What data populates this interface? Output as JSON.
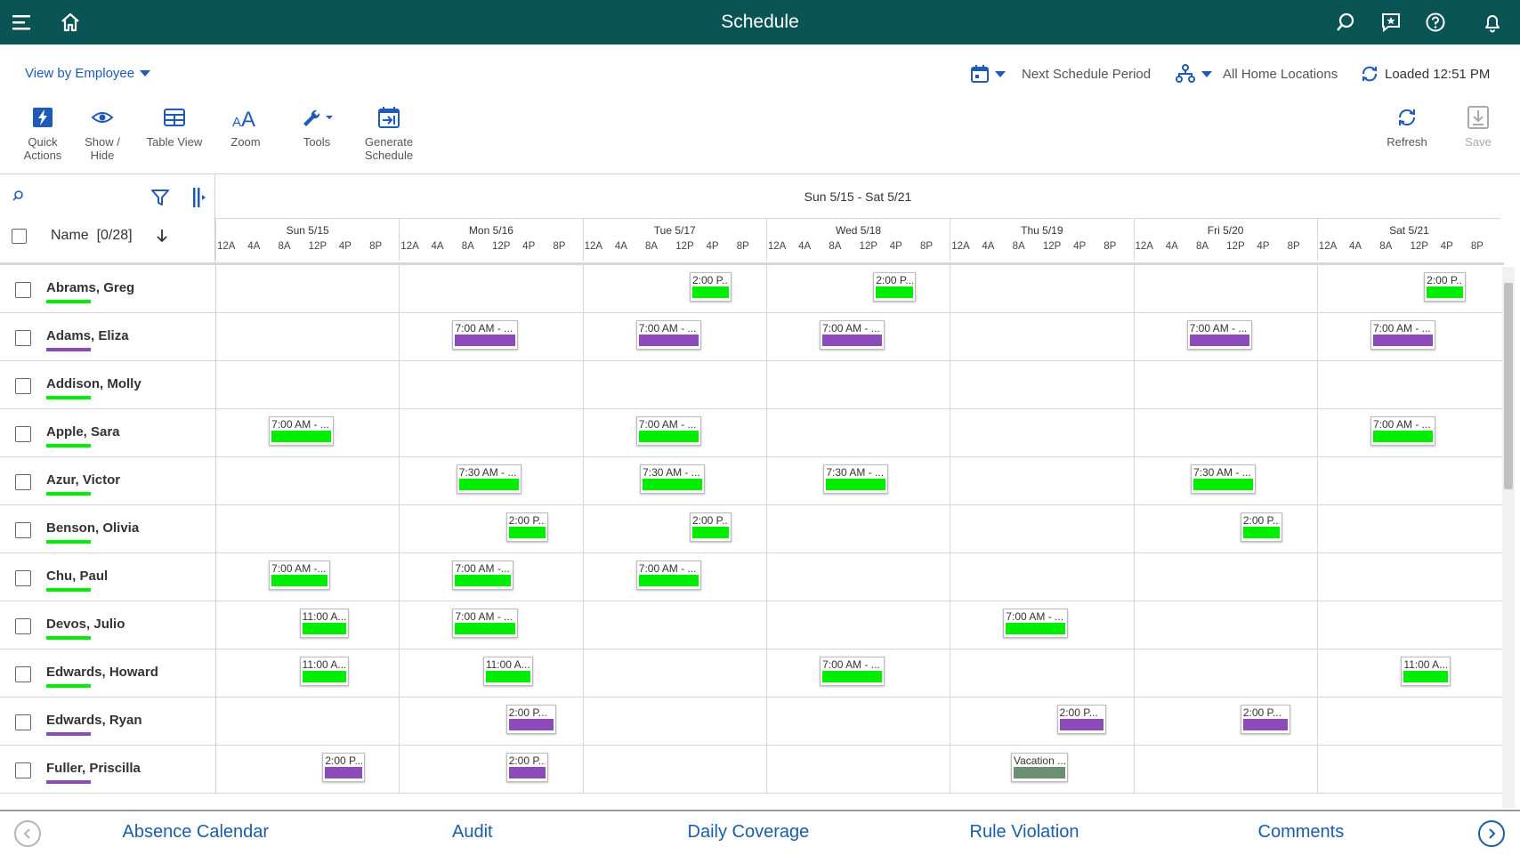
{
  "header": {
    "title": "Schedule"
  },
  "subheader": {
    "view_by": "View by Employee",
    "schedule_period": "Next Schedule Period",
    "locations": "All Home Locations",
    "loaded": "Loaded 12:51 PM"
  },
  "toolbar": {
    "quick_actions_1": "Quick",
    "quick_actions_2": "Actions",
    "show_hide_1": "Show /",
    "show_hide_2": "Hide",
    "table_view": "Table View",
    "zoom": "Zoom",
    "tools": "Tools",
    "generate_1": "Generate",
    "generate_2": "Schedule",
    "refresh": "Refresh",
    "save": "Save"
  },
  "grid": {
    "period": "Sun 5/15 - Sat 5/21",
    "name_header": "Name",
    "name_count": "[0/28]",
    "days": [
      "Sun 5/15",
      "Mon 5/16",
      "Tue 5/17",
      "Wed 5/18",
      "Thu 5/19",
      "Fri 5/20",
      "Sat 5/21"
    ],
    "ticks": [
      "12A",
      "4A",
      "8A",
      "12P",
      "4P",
      "8P"
    ]
  },
  "colors": {
    "green": "#00ee00",
    "purple": "#8b4bb8",
    "vacation": "#6b8f73",
    "teal": "#0b5455",
    "link": "#1a5ea8"
  },
  "employees": [
    {
      "name": "Abrams, Greg",
      "bar": "green",
      "shifts": [
        {
          "day": 2,
          "start": 14,
          "dur": 5.5,
          "label": "2:00 P...",
          "color": "green"
        },
        {
          "day": 3,
          "start": 14,
          "dur": 5.5,
          "label": "2:00 P...",
          "color": "green"
        },
        {
          "day": 6,
          "start": 14,
          "dur": 5.5,
          "label": "2:00 P...",
          "color": "green"
        }
      ]
    },
    {
      "name": "Adams, Eliza",
      "bar": "purple",
      "shifts": [
        {
          "day": 1,
          "start": 7,
          "dur": 8.5,
          "label": "7:00 AM - ...",
          "color": "purple"
        },
        {
          "day": 2,
          "start": 7,
          "dur": 8.5,
          "label": "7:00 AM - ...",
          "color": "purple"
        },
        {
          "day": 3,
          "start": 7,
          "dur": 8.5,
          "label": "7:00 AM - ...",
          "color": "purple"
        },
        {
          "day": 5,
          "start": 7,
          "dur": 8.5,
          "label": "7:00 AM - ...",
          "color": "purple"
        },
        {
          "day": 6,
          "start": 7,
          "dur": 8.5,
          "label": "7:00 AM - ...",
          "color": "purple"
        }
      ]
    },
    {
      "name": "Addison, Molly",
      "bar": "green",
      "shifts": []
    },
    {
      "name": "Apple, Sara",
      "bar": "green",
      "shifts": [
        {
          "day": 0,
          "start": 7,
          "dur": 8.5,
          "label": "7:00 AM - ...",
          "color": "green"
        },
        {
          "day": 2,
          "start": 7,
          "dur": 8.5,
          "label": "7:00 AM - ...",
          "color": "green"
        },
        {
          "day": 6,
          "start": 7,
          "dur": 8.5,
          "label": "7:00 AM - ...",
          "color": "green"
        }
      ]
    },
    {
      "name": "Azur, Victor",
      "bar": "green",
      "shifts": [
        {
          "day": 1,
          "start": 7.5,
          "dur": 8.5,
          "label": "7:30 AM - ...",
          "color": "green"
        },
        {
          "day": 2,
          "start": 7.5,
          "dur": 8.5,
          "label": "7:30 AM - ...",
          "color": "green"
        },
        {
          "day": 3,
          "start": 7.5,
          "dur": 8.5,
          "label": "7:30 AM - ...",
          "color": "green"
        },
        {
          "day": 5,
          "start": 7.5,
          "dur": 8.5,
          "label": "7:30 AM - ...",
          "color": "green"
        }
      ]
    },
    {
      "name": "Benson, Olivia",
      "bar": "green",
      "shifts": [
        {
          "day": 1,
          "start": 14,
          "dur": 5.5,
          "label": "2:00 P...",
          "color": "green"
        },
        {
          "day": 2,
          "start": 14,
          "dur": 5.5,
          "label": "2:00 P...",
          "color": "green"
        },
        {
          "day": 5,
          "start": 14,
          "dur": 5.5,
          "label": "2:00 P...",
          "color": "green"
        }
      ]
    },
    {
      "name": "Chu, Paul",
      "bar": "green",
      "shifts": [
        {
          "day": 0,
          "start": 7,
          "dur": 8,
          "label": "7:00 AM -...",
          "color": "green"
        },
        {
          "day": 1,
          "start": 7,
          "dur": 8,
          "label": "7:00 AM -...",
          "color": "green"
        },
        {
          "day": 2,
          "start": 7,
          "dur": 8.5,
          "label": "7:00 AM - ...",
          "color": "green"
        }
      ]
    },
    {
      "name": "Devos, Julio",
      "bar": "green",
      "shifts": [
        {
          "day": 0,
          "start": 11,
          "dur": 6.5,
          "label": "11:00 A...",
          "color": "green"
        },
        {
          "day": 1,
          "start": 7,
          "dur": 8.5,
          "label": "7:00 AM - ...",
          "color": "green"
        },
        {
          "day": 4,
          "start": 7,
          "dur": 8.5,
          "label": "7:00 AM - ...",
          "color": "green"
        }
      ]
    },
    {
      "name": "Edwards, Howard",
      "bar": "green",
      "shifts": [
        {
          "day": 0,
          "start": 11,
          "dur": 6.5,
          "label": "11:00 A...",
          "color": "green"
        },
        {
          "day": 1,
          "start": 11,
          "dur": 6.5,
          "label": "11:00 A...",
          "color": "green"
        },
        {
          "day": 3,
          "start": 7,
          "dur": 8.5,
          "label": "7:00 AM - ...",
          "color": "green"
        },
        {
          "day": 6,
          "start": 11,
          "dur": 6.5,
          "label": "11:00 A...",
          "color": "green"
        }
      ]
    },
    {
      "name": "Edwards, Ryan",
      "bar": "purple",
      "shifts": [
        {
          "day": 1,
          "start": 14,
          "dur": 6.5,
          "label": "2:00 P...",
          "color": "purple"
        },
        {
          "day": 4,
          "start": 14,
          "dur": 6.5,
          "label": "2:00 P...",
          "color": "purple"
        },
        {
          "day": 5,
          "start": 14,
          "dur": 6.5,
          "label": "2:00 P...",
          "color": "purple"
        }
      ]
    },
    {
      "name": "Fuller, Priscilla",
      "bar": "purple",
      "shifts": [
        {
          "day": 0,
          "start": 14,
          "dur": 5.5,
          "label": "2:00 P...",
          "color": "purple"
        },
        {
          "day": 1,
          "start": 14,
          "dur": 5.5,
          "label": "2:00 P...",
          "color": "purple"
        },
        {
          "day": 4,
          "start": 8,
          "dur": 7.5,
          "label": "Vacation ...",
          "color": "vacation"
        }
      ]
    }
  ],
  "bottom": {
    "links": [
      "Absence Calendar",
      "Audit",
      "Daily Coverage",
      "Rule Violation",
      "Comments"
    ]
  }
}
